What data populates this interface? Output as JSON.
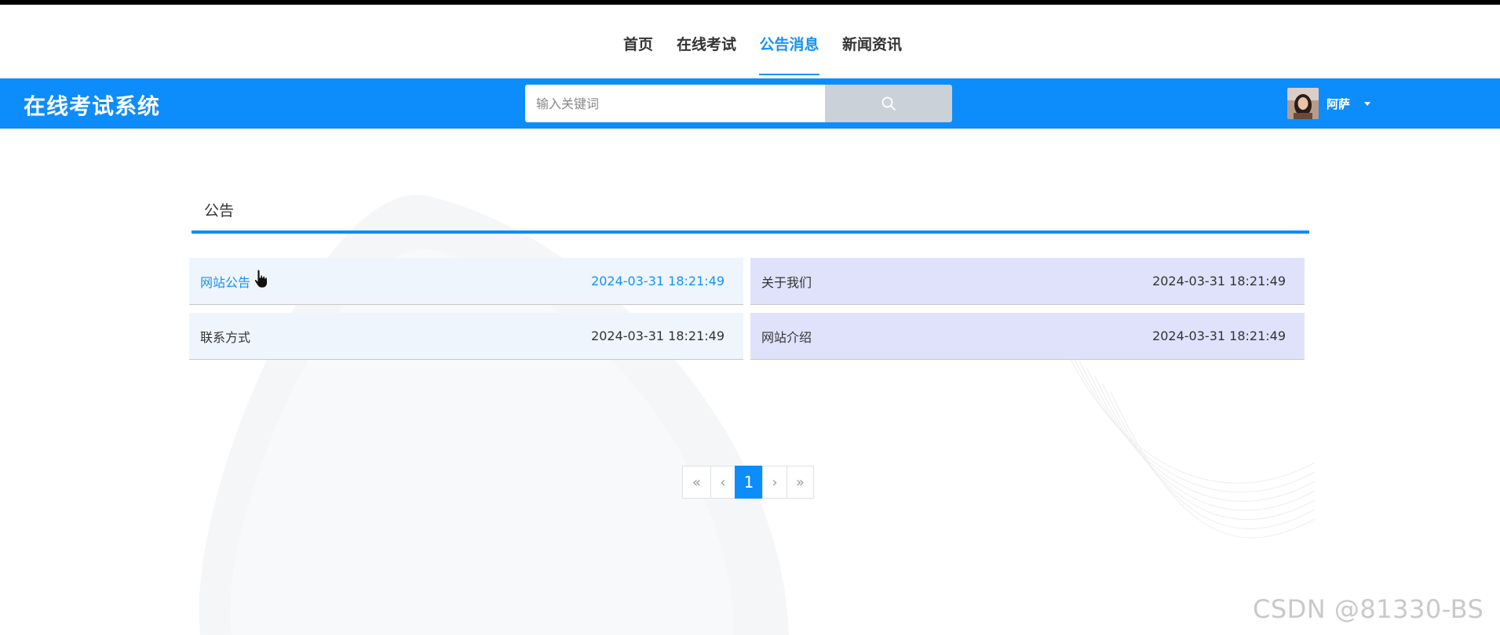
{
  "nav": {
    "items": [
      {
        "label": "首页",
        "active": false
      },
      {
        "label": "在线考试",
        "active": false
      },
      {
        "label": "公告消息",
        "active": true
      },
      {
        "label": "新闻资讯",
        "active": false
      }
    ]
  },
  "header": {
    "brand": "在线考试系统",
    "search": {
      "placeholder": "输入关键词",
      "value": "",
      "button_icon": "search-icon"
    },
    "user": {
      "name": "阿萨",
      "menu_icon": "caret-down-icon"
    }
  },
  "section": {
    "title": "公告",
    "notices": [
      {
        "title": "网站公告",
        "time": "2024-03-31 18:21:49"
      },
      {
        "title": "关于我们",
        "time": "2024-03-31 18:21:49"
      },
      {
        "title": "联系方式",
        "time": "2024-03-31 18:21:49"
      },
      {
        "title": "网站介绍",
        "time": "2024-03-31 18:21:49"
      }
    ]
  },
  "pagination": {
    "first": "«",
    "prev": "‹",
    "current": "1",
    "next": "›",
    "last": "»"
  },
  "colors": {
    "primary": "#0d8cfb",
    "active_nav": "#1592f5",
    "row_light": "#eef5fd",
    "row_lavender": "#e0e2fc"
  },
  "watermark": "CSDN @81330-BS"
}
